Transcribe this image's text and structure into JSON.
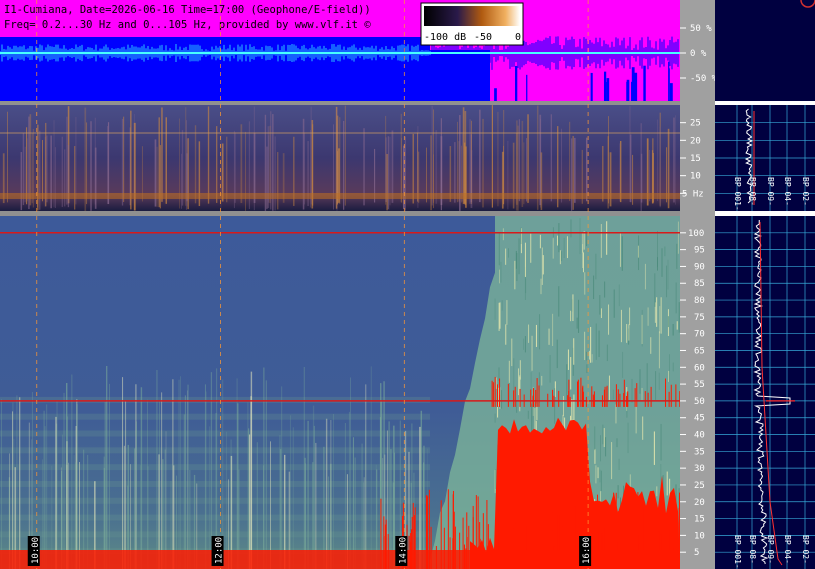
{
  "header": {
    "line1": "I1-Cumiana, Date=2026-06-16 Time=17:00 (Geophone/E-field))",
    "line2": "Freq= 0.2...30 Hz and 0...105 Hz, provided by www.vlf.it ©"
  },
  "colorbar": {
    "labels": [
      "-100 dB",
      "-50",
      "0"
    ]
  },
  "chart_data": [
    {
      "type": "line",
      "title": "",
      "xlabel": "",
      "ylabel": "",
      "ylim": [
        -100,
        100
      ],
      "y_ticks": [
        "50 %",
        "0 %",
        "-50 %"
      ],
      "series": [
        {
          "values": [
            0,
            0,
            0,
            0,
            0,
            0,
            0,
            0
          ]
        }
      ],
      "background": {
        "colors": [
          "#ff00ff",
          "#0000ff"
        ]
      }
    },
    {
      "type": "heatmap",
      "title": "",
      "xlabel": "",
      "ylabel": "",
      "ylim": [
        0,
        30
      ],
      "y_ticks": [
        "25",
        "20",
        "15",
        "10",
        "5 Hz"
      ],
      "y_tick_values": [
        25,
        20,
        15,
        10,
        5
      ]
    },
    {
      "type": "heatmap",
      "title": "",
      "xlabel": "",
      "ylabel": "",
      "ylim": [
        0,
        105
      ],
      "y_ticks": [
        "100",
        "95",
        "90",
        "85",
        "80",
        "75",
        "70",
        "65",
        "60",
        "55",
        "50",
        "45",
        "40",
        "35",
        "30",
        "25",
        "20",
        "15",
        "10",
        "5"
      ],
      "y_tick_values": [
        100,
        95,
        90,
        85,
        80,
        75,
        70,
        65,
        60,
        55,
        50,
        45,
        40,
        35,
        30,
        25,
        20,
        15,
        10,
        5
      ],
      "x_ticks": [
        "10:00",
        "12:00",
        "14:00",
        "16:00"
      ],
      "x_tick_hours": [
        10,
        12,
        14,
        16
      ],
      "x_range_hours": [
        9.6,
        17.0
      ],
      "spectral_lines_hz": [
        50,
        100
      ]
    },
    {
      "type": "line",
      "title": "",
      "xlabel": "",
      "ylabel": "",
      "ylim": [
        0,
        30
      ],
      "x_ticks": [
        "-100 dB",
        "-80 dB",
        "-60 dB",
        "-40 dB",
        "-20 dB"
      ],
      "x_tick_labels_rendered": [
        "BP 001-",
        "BP 08-",
        "BP 09-",
        "BP 04-",
        "BP 02-"
      ]
    },
    {
      "type": "line",
      "title": "",
      "xlabel": "",
      "ylabel": "",
      "ylim": [
        0,
        105
      ],
      "x_tick_labels_rendered": [
        "BP 001-",
        "BP 08-",
        "BP 09-",
        "BP 04-",
        "BP 02-"
      ]
    }
  ],
  "colors": {
    "amp_top": "#ff00ff",
    "amp_bottom": "#0000ff",
    "axis_panel": "#a0a0a0",
    "right_panel": "#000040",
    "spectrum_bg": "#3b5898",
    "red_line": "#d81a1a",
    "time_grid": "#ff9933",
    "grid_cyan": "#36a9d8"
  }
}
